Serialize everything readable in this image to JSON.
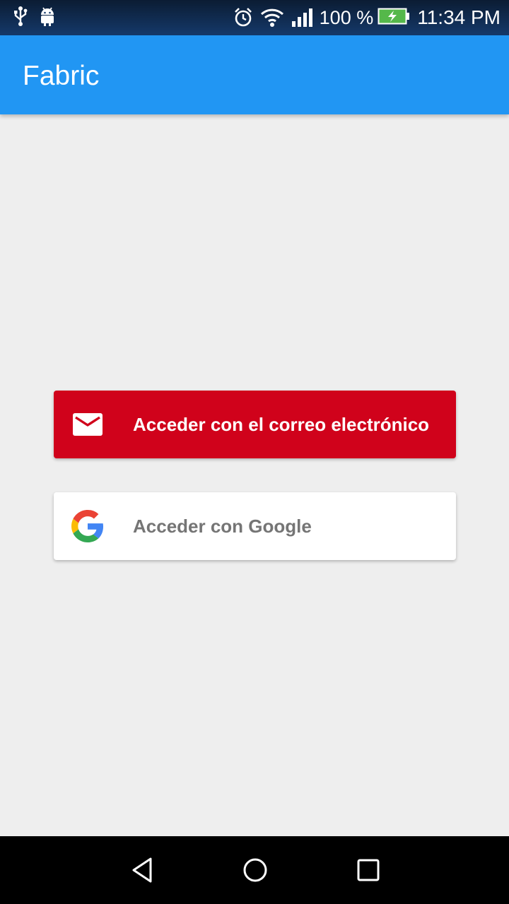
{
  "status_bar": {
    "icons_left": [
      "usb-icon",
      "android-debug-icon"
    ],
    "icons_right": [
      "alarm-icon",
      "wifi-icon",
      "signal-icon",
      "battery-charging-icon"
    ],
    "battery_text": "100 %",
    "time": "11:34 PM"
  },
  "app_bar": {
    "title": "Fabric",
    "color": "#2196f3"
  },
  "sign_in": {
    "email_button": {
      "label": "Acceder con el correo electrónico",
      "icon": "mail-icon",
      "color": "#d0021b"
    },
    "google_button": {
      "label": "Acceder con Google",
      "icon": "google-logo-icon",
      "color": "#ffffff"
    }
  },
  "nav_bar": {
    "icons": [
      "back-icon",
      "home-icon",
      "recents-icon"
    ]
  }
}
